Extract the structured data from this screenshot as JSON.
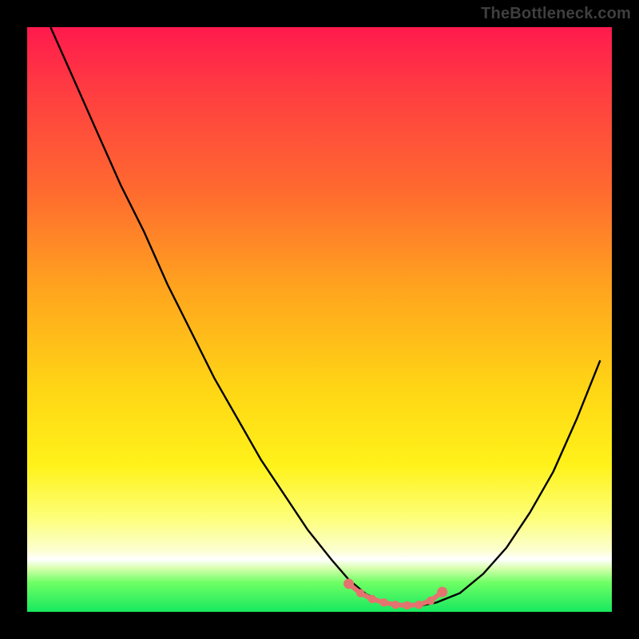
{
  "watermark": {
    "text": "TheBottleneck.com"
  },
  "colors": {
    "curve": "#000000",
    "marker_fill": "#e4736f",
    "marker_stroke": "#c85a56",
    "background_top": "#ff1a4d",
    "background_bottom": "#17e85f"
  },
  "chart_data": {
    "type": "line",
    "title": "",
    "xlabel": "",
    "ylabel": "",
    "xlim": [
      0,
      100
    ],
    "ylim": [
      0,
      100
    ],
    "series": [
      {
        "name": "bottleneck-curve",
        "x": [
          4,
          8,
          12,
          16,
          20,
          24,
          28,
          32,
          36,
          40,
          44,
          48,
          52,
          55,
          58,
          61,
          64,
          67,
          70,
          74,
          78,
          82,
          86,
          90,
          94,
          98
        ],
        "y": [
          100,
          91,
          82,
          73,
          65,
          56,
          48,
          40,
          33,
          26,
          20,
          14,
          9,
          5.5,
          3,
          1.6,
          1.0,
          1.0,
          1.6,
          3.2,
          6.5,
          11,
          17,
          24,
          33,
          43
        ]
      }
    ],
    "markers": {
      "name": "highlight-band",
      "x": [
        55,
        57,
        59,
        61,
        63,
        65,
        67,
        69,
        71
      ],
      "y": [
        4.8,
        3.2,
        2.2,
        1.6,
        1.2,
        1.1,
        1.2,
        1.9,
        3.4
      ]
    }
  }
}
